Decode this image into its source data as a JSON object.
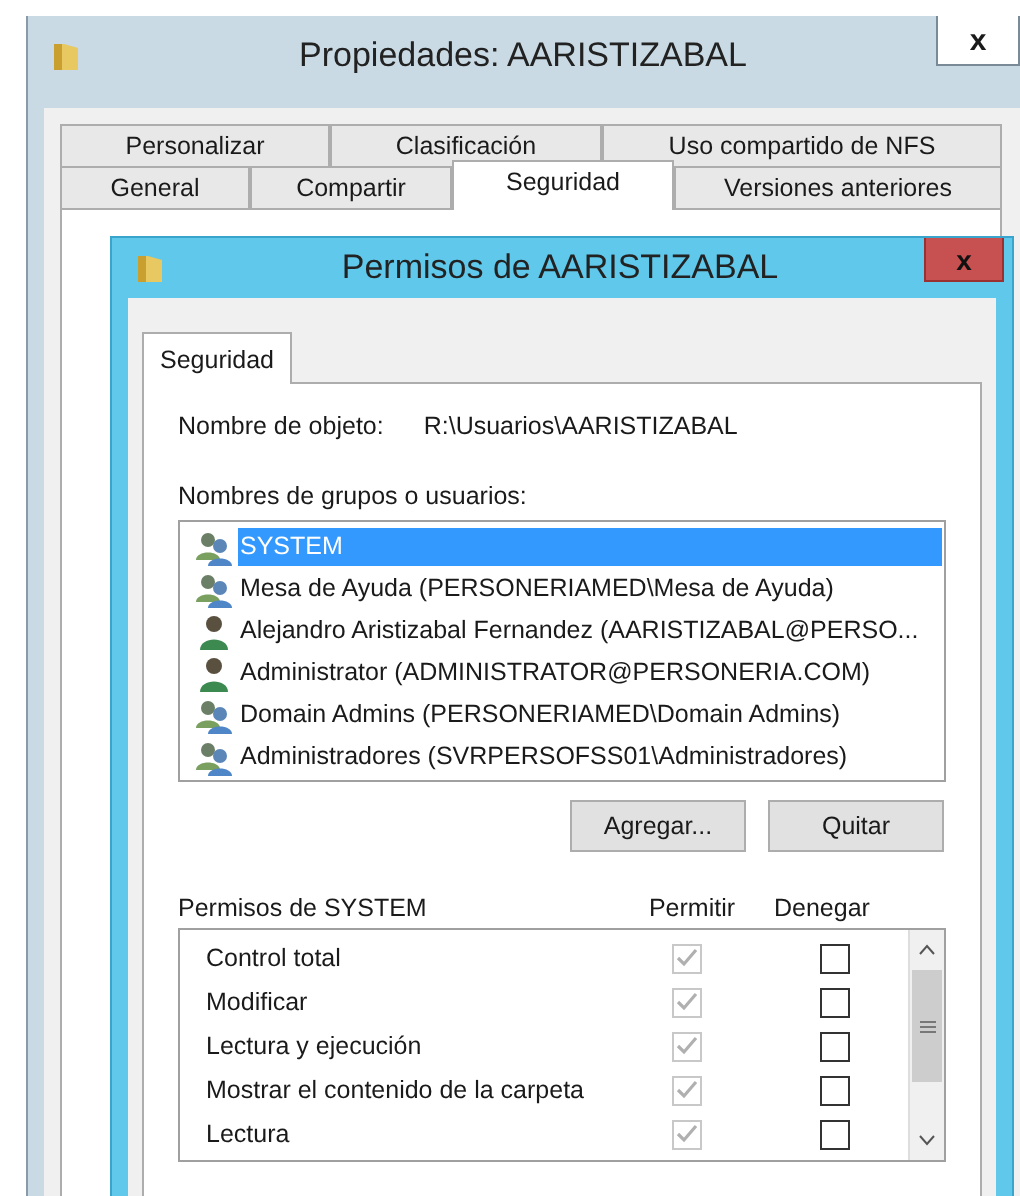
{
  "properties_window": {
    "title": "Propiedades: AARISTIZABAL",
    "close": "x",
    "tab_rows": [
      [
        {
          "label": "Personalizar",
          "selected": false
        },
        {
          "label": "Clasificación",
          "selected": false
        },
        {
          "label": "Uso compartido de NFS",
          "selected": false
        }
      ],
      [
        {
          "label": "General",
          "selected": false
        },
        {
          "label": "Compartir",
          "selected": false
        },
        {
          "label": "Seguridad",
          "selected": true
        },
        {
          "label": "Versiones anteriores",
          "selected": false
        }
      ]
    ]
  },
  "permissions_dialog": {
    "title": "Permisos de AARISTIZABAL",
    "close": "x",
    "tabs": [
      {
        "label": "Seguridad",
        "selected": true
      }
    ],
    "object_name_label": "Nombre de objeto:",
    "object_name": "R:\\Usuarios\\AARISTIZABAL",
    "principals_label": "Nombres de grupos o usuarios:",
    "principals": [
      {
        "name": "SYSTEM",
        "kind": "group",
        "selected": true
      },
      {
        "name": "Mesa de Ayuda (PERSONERIAMED\\Mesa de Ayuda)",
        "kind": "group",
        "selected": false
      },
      {
        "name": "Alejandro Aristizabal Fernandez (AARISTIZABAL@PERSO...",
        "kind": "user",
        "selected": false
      },
      {
        "name": "Administrator (ADMINISTRATOR@PERSONERIA.COM)",
        "kind": "user",
        "selected": false
      },
      {
        "name": "Domain Admins (PERSONERIAMED\\Domain Admins)",
        "kind": "group",
        "selected": false
      },
      {
        "name": "Administradores (SVRPERSOFSS01\\Administradores)",
        "kind": "group",
        "selected": false
      }
    ],
    "buttons": [
      "Agregar...",
      "Quitar"
    ],
    "permissions_label": "Permisos de SYSTEM",
    "allow_header": "Permitir",
    "deny_header": "Denegar",
    "permissions": [
      {
        "name": "Control total",
        "allow": true,
        "allow_disabled": true,
        "deny": false
      },
      {
        "name": "Modificar",
        "allow": true,
        "allow_disabled": true,
        "deny": false
      },
      {
        "name": "Lectura y ejecución",
        "allow": true,
        "allow_disabled": true,
        "deny": false
      },
      {
        "name": "Mostrar el contenido de la carpeta",
        "allow": true,
        "allow_disabled": true,
        "deny": false
      },
      {
        "name": "Lectura",
        "allow": true,
        "allow_disabled": true,
        "deny": false
      }
    ]
  }
}
